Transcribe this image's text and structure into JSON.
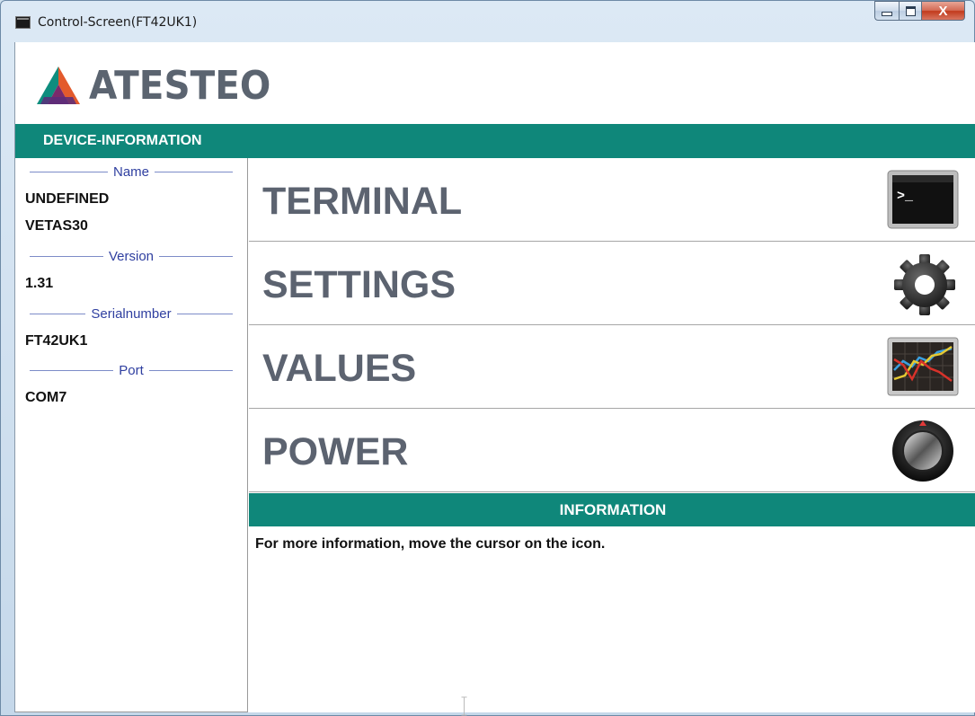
{
  "window": {
    "title": "Control-Screen(FT42UK1)",
    "controls": {
      "minimize": "minimize",
      "maximize": "maximize",
      "close": "X"
    }
  },
  "brand": {
    "logo_text": "ATESTEO"
  },
  "device_info": {
    "header": "DEVICE-INFORMATION",
    "sections": [
      {
        "label": "Name",
        "values": [
          "UNDEFINED",
          "VETAS30"
        ]
      },
      {
        "label": "Version",
        "values": [
          "1.31"
        ]
      },
      {
        "label": "Serialnumber",
        "values": [
          "FT42UK1"
        ]
      },
      {
        "label": "Port",
        "values": [
          "COM7"
        ]
      }
    ]
  },
  "menu": {
    "items": [
      {
        "label": "TERMINAL",
        "icon": "terminal-icon"
      },
      {
        "label": "SETTINGS",
        "icon": "gear-icon"
      },
      {
        "label": "VALUES",
        "icon": "chart-icon"
      },
      {
        "label": "POWER",
        "icon": "power-knob-icon"
      }
    ]
  },
  "information": {
    "header": "INFORMATION",
    "text": "For more information, move the cursor on the icon."
  },
  "colors": {
    "accent": "#0f877a",
    "menu_text": "#5c6370",
    "label_blue": "#2f3fa0"
  }
}
